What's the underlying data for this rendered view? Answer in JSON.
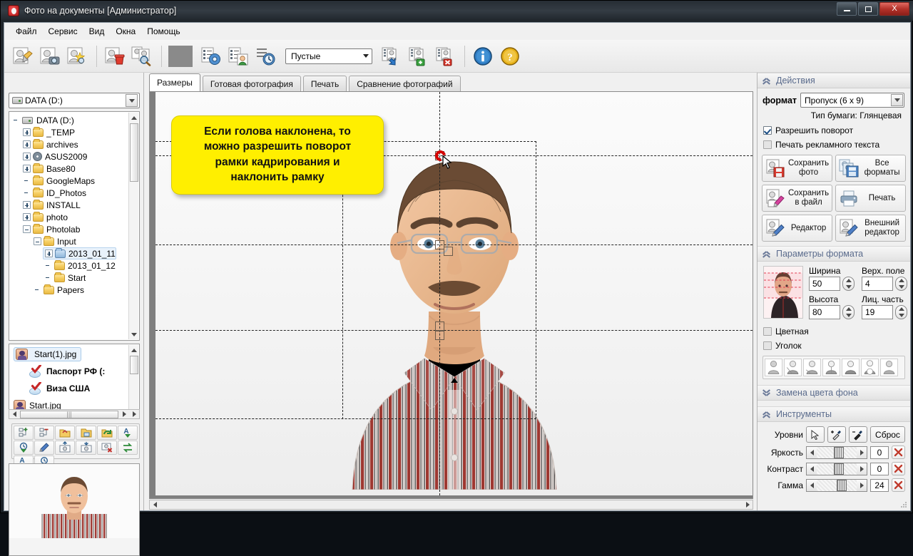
{
  "window": {
    "title": "Фото на документы  [Администратор]",
    "icon": "app-camera-icon",
    "buttons": {
      "minimize": "—",
      "maximize": "□",
      "close": "X"
    }
  },
  "menu": {
    "items": [
      "Файл",
      "Сервис",
      "Вид",
      "Окна",
      "Помощь"
    ]
  },
  "toolbar": {
    "buttons": [
      {
        "name": "open-photo-icon",
        "title": "Открыть фото"
      },
      {
        "name": "capture-camera-icon",
        "title": "Снимок с камеры"
      },
      {
        "name": "new-photo-icon",
        "title": "Новое фото"
      },
      {
        "name": "delete-photo-icon",
        "title": "Удалить фото"
      },
      {
        "name": "search-photos-icon",
        "title": "Поиск фото"
      },
      {
        "name": "settings-gear-icon",
        "title": "Настройки"
      },
      {
        "name": "person-list-icon",
        "title": "Клиенты"
      },
      {
        "name": "history-clock-icon",
        "title": "История"
      },
      {
        "name": "list-select-icon",
        "title": "Выбрать заказ"
      },
      {
        "name": "list-add-icon",
        "title": "Добавить заказ"
      },
      {
        "name": "list-remove-icon",
        "title": "Удалить заказ"
      },
      {
        "name": "info-icon",
        "title": "О программе"
      },
      {
        "name": "help-icon",
        "title": "Помощь"
      }
    ],
    "order_combo": {
      "value": "Пустые"
    }
  },
  "left_panel": {
    "drive_combo": {
      "value": "DATA (D:)"
    },
    "tree": [
      {
        "label": "DATA (D:)",
        "indent": 0,
        "expander": "none",
        "icon": "drive-icon"
      },
      {
        "label": "_TEMP",
        "indent": 1,
        "expander": "plus",
        "icon": "folder"
      },
      {
        "label": "archives",
        "indent": 1,
        "expander": "plus",
        "icon": "folder"
      },
      {
        "label": "ASUS2009",
        "indent": 1,
        "expander": "plus",
        "icon": "cd"
      },
      {
        "label": "Base80",
        "indent": 1,
        "expander": "plus",
        "icon": "folder"
      },
      {
        "label": "GoogleMaps",
        "indent": 1,
        "expander": "none",
        "icon": "folder"
      },
      {
        "label": "ID_Photos",
        "indent": 1,
        "expander": "none",
        "icon": "folder"
      },
      {
        "label": "INSTALL",
        "indent": 1,
        "expander": "plus",
        "icon": "folder"
      },
      {
        "label": "photo",
        "indent": 1,
        "expander": "plus",
        "icon": "folder"
      },
      {
        "label": "Photolab",
        "indent": 1,
        "expander": "minus",
        "icon": "folder"
      },
      {
        "label": "Input",
        "indent": 2,
        "expander": "minus",
        "icon": "folder"
      },
      {
        "label": "2013_01_11",
        "indent": 3,
        "expander": "plus",
        "icon": "folder-blue",
        "selected": true
      },
      {
        "label": "2013_01_12",
        "indent": 3,
        "expander": "none",
        "icon": "folder"
      },
      {
        "label": "Start",
        "indent": 3,
        "expander": "none",
        "icon": "folder"
      },
      {
        "label": "Papers",
        "indent": 2,
        "expander": "none",
        "icon": "folder"
      }
    ],
    "file_list": [
      {
        "label": "Start(1).jpg",
        "icon": "person-icon",
        "selected": true,
        "bold": false,
        "indent": 0
      },
      {
        "label": "Паспорт РФ (:",
        "icon": "check-icon",
        "selected": false,
        "bold": true,
        "indent": 1
      },
      {
        "label": "Виза США",
        "icon": "check-icon",
        "selected": false,
        "bold": true,
        "indent": 1
      },
      {
        "label": "Start.jpg",
        "icon": "person-icon",
        "selected": false,
        "bold": false,
        "indent": 0
      }
    ],
    "mini_toolbar": [
      "add-item-icon",
      "remove-item-icon",
      "open-folder-icon",
      "save-folder-icon",
      "refresh-folder-icon",
      "sort-az-down-icon",
      "sort-date-down-icon",
      "edit-pencil-icon",
      "prev-photo-icon",
      "next-photo-icon",
      "delete-photo-icon",
      "swap-icon",
      "sort-az-up-icon",
      "sort-date-up-icon"
    ],
    "preview": {
      "name": "photo-preview"
    }
  },
  "center": {
    "tabs": [
      {
        "label": "Размеры",
        "active": true
      },
      {
        "label": "Готовая фотография",
        "active": false
      },
      {
        "label": "Печать",
        "active": false
      },
      {
        "label": "Сравнение фотографий",
        "active": false
      }
    ],
    "callout": {
      "lines": [
        "Если голова наклонена, то",
        "можно разрешить поворот",
        "рамки кадрирования и",
        "наклонить рамку"
      ],
      "bg_color": "#ffef00"
    },
    "cursor": {
      "tool": "rotate-handle-cursor",
      "color": "#d40000"
    }
  },
  "right_panel": {
    "groups": [
      {
        "title": "Действия",
        "state": "expanded"
      },
      {
        "title": "Параметры формата",
        "state": "expanded"
      },
      {
        "title": "Замена цвета фона",
        "state": "collapsed"
      },
      {
        "title": "Инструменты",
        "state": "expanded"
      }
    ],
    "actions": {
      "format_label": "формат",
      "format_value": "Пропуск (6 x 9)",
      "paper_label": "Тип бумаги:",
      "paper_value": "Глянцевая",
      "checkboxes": [
        {
          "label": "Разрешить поворот",
          "checked": true
        },
        {
          "label": "Печать рекламного текста",
          "checked": false
        }
      ],
      "buttons": [
        {
          "label": "Сохранить\nфото",
          "icon": "save-photo-icon"
        },
        {
          "label": "Все\nформаты",
          "icon": "all-formats-icon"
        },
        {
          "label": "Сохранить\nв файл",
          "icon": "save-file-icon"
        },
        {
          "label": "Печать",
          "icon": "printer-icon"
        },
        {
          "label": "Редактор",
          "icon": "editor-icon"
        },
        {
          "label": "Внешний\nредактор",
          "icon": "external-editor-icon"
        }
      ]
    },
    "format_params": {
      "fields": [
        {
          "label": "Ширина",
          "value": "50"
        },
        {
          "label": "Верх. поле",
          "value": "4"
        },
        {
          "label": "Высота",
          "value": "80"
        },
        {
          "label": "Лиц. часть",
          "value": "19"
        }
      ],
      "checkboxes": [
        {
          "label": "Цветная",
          "checked": false
        },
        {
          "label": "Уголок",
          "checked": false
        }
      ],
      "pose_count": 7
    },
    "tools": {
      "levels_label": "Уровни",
      "levels_buttons": [
        "pointer-icon",
        "white-picker-icon",
        "black-picker-icon"
      ],
      "reset_label": "Сброс",
      "sliders": [
        {
          "label": "Яркость",
          "value": "0",
          "pos": 46
        },
        {
          "label": "Контраст",
          "value": "0",
          "pos": 46
        },
        {
          "label": "Гамма",
          "value": "24",
          "pos": 54
        }
      ]
    }
  }
}
